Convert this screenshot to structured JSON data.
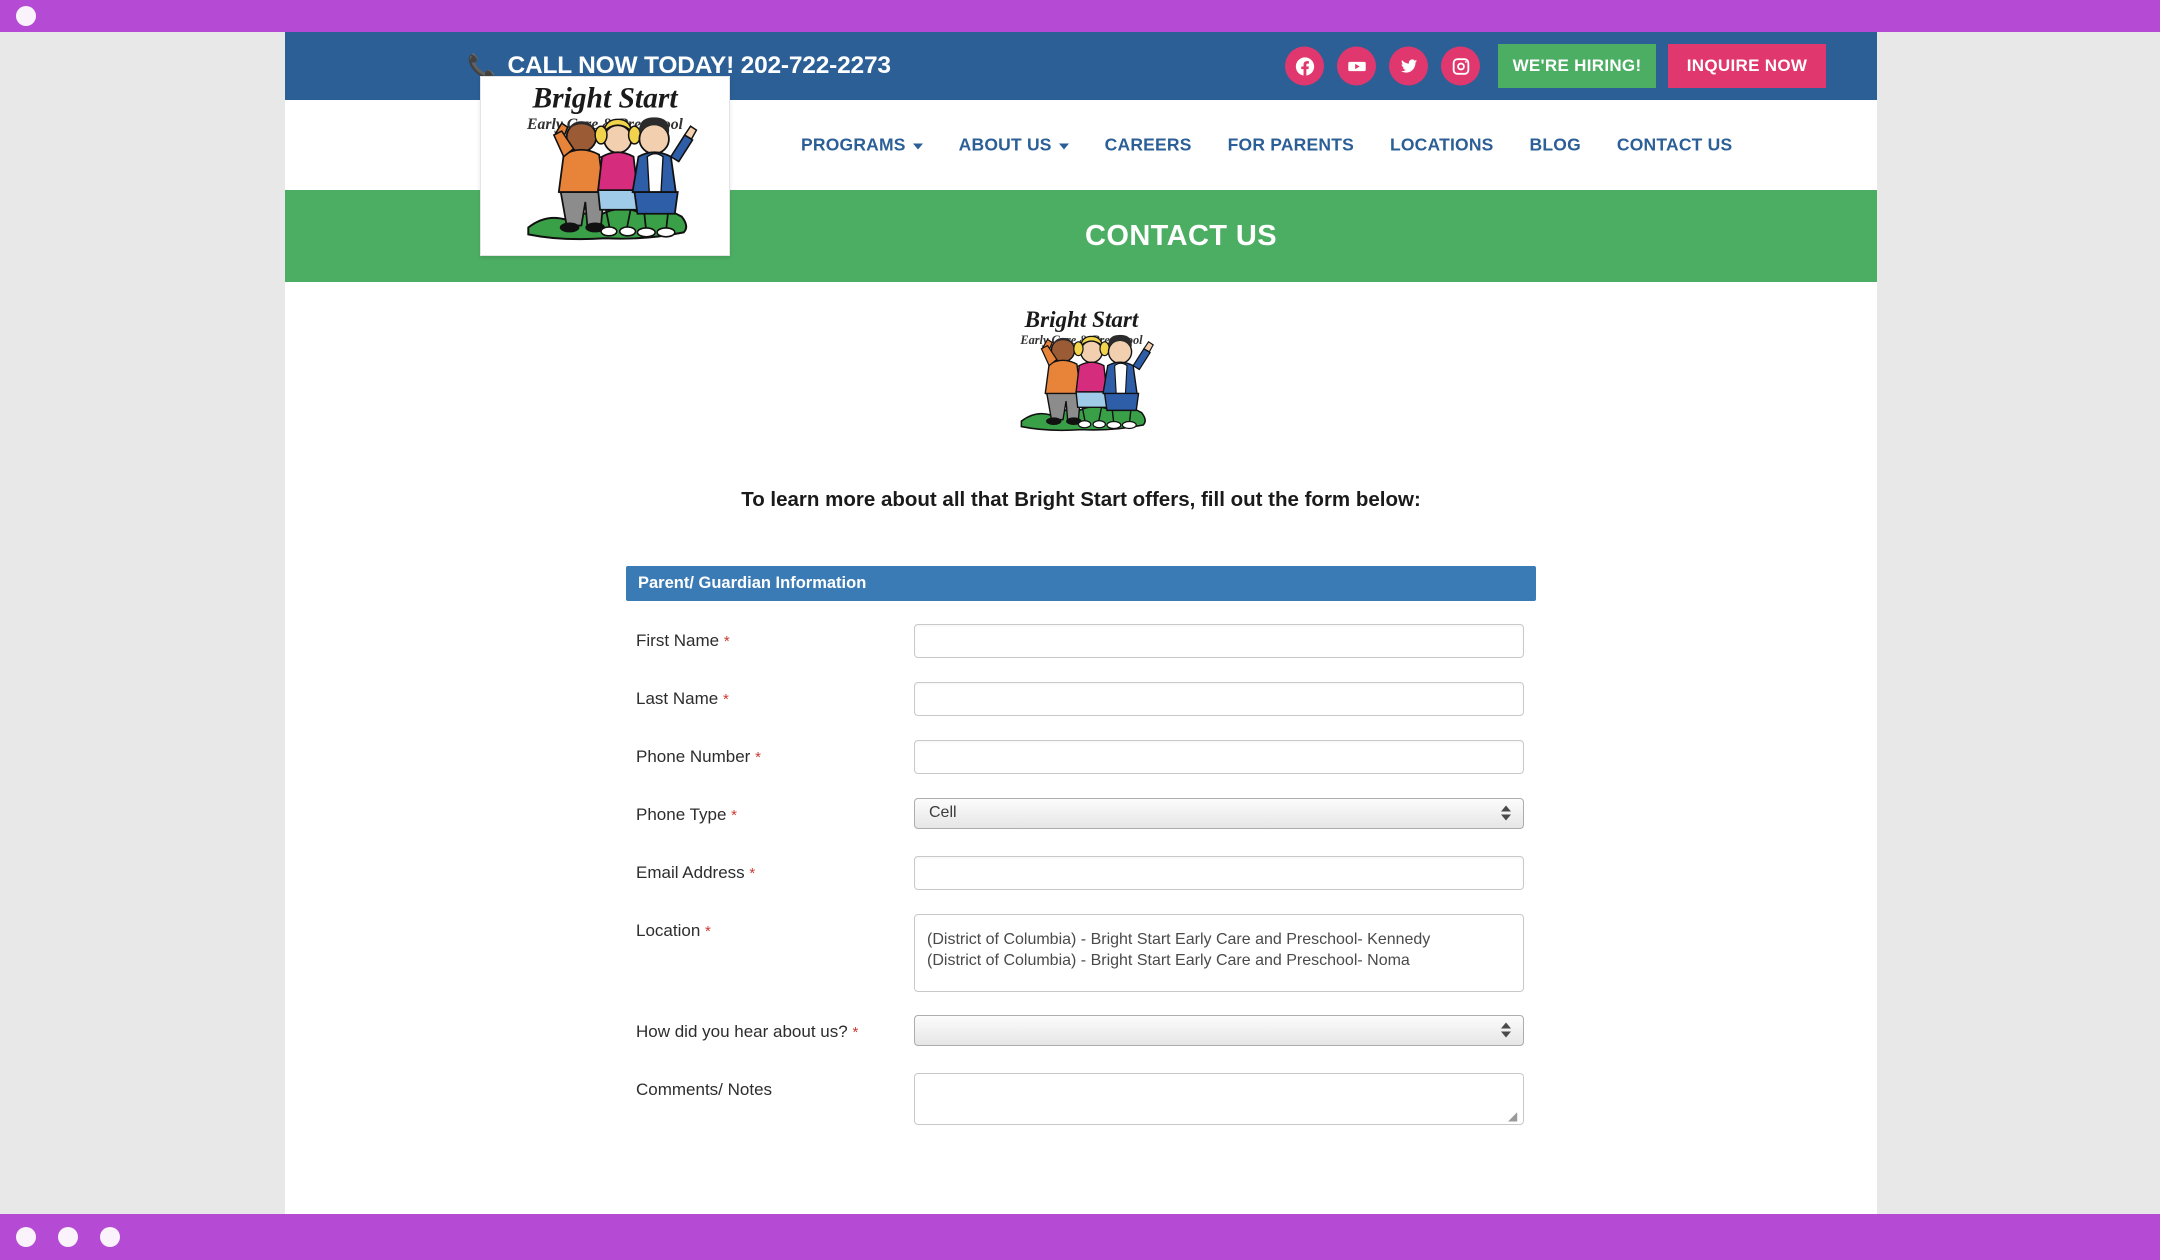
{
  "browser": {
    "top_dots": 1,
    "bottom_dots": 3,
    "chrome_color": "#b54ad4"
  },
  "topbar": {
    "phone_icon": "phone-icon",
    "call_text": "CALL NOW TODAY! 202-722-2273",
    "social": [
      {
        "name": "facebook-icon",
        "label": "Facebook"
      },
      {
        "name": "youtube-icon",
        "label": "YouTube"
      },
      {
        "name": "twitter-icon",
        "label": "Twitter"
      },
      {
        "name": "instagram-icon",
        "label": "Instagram"
      }
    ],
    "hiring_label": "WE'RE HIRING!",
    "inquire_label": "INQUIRE NOW",
    "bg_color": "#2b5f96",
    "hiring_color": "#4cae63",
    "inquire_color": "#e0386e"
  },
  "logo": {
    "title": "Bright Start",
    "subtitle": "Early Care & Preschool"
  },
  "nav": {
    "items": [
      {
        "label": "PROGRAMS",
        "caret": true
      },
      {
        "label": "ABOUT US",
        "caret": true
      },
      {
        "label": "CAREERS",
        "caret": false
      },
      {
        "label": "FOR PARENTS",
        "caret": false
      },
      {
        "label": "LOCATIONS",
        "caret": false
      },
      {
        "label": "BLOG",
        "caret": false
      },
      {
        "label": "CONTACT US",
        "caret": false
      }
    ],
    "color": "#2b5f96"
  },
  "page": {
    "title_band": "CONTACT US",
    "band_color": "#4cae63",
    "lede": "To learn more about all that Bright Start offers, fill out the form below:"
  },
  "form": {
    "section_title": "Parent/ Guardian Information",
    "section_color": "#3b7bb5",
    "required_mark": "*",
    "fields": [
      {
        "label": "First Name",
        "required": true,
        "type": "text",
        "value": ""
      },
      {
        "label": "Last Name",
        "required": true,
        "type": "text",
        "value": ""
      },
      {
        "label": "Phone Number",
        "required": true,
        "type": "text",
        "value": ""
      },
      {
        "label": "Phone Type",
        "required": true,
        "type": "select",
        "value": "Cell"
      },
      {
        "label": "Email Address",
        "required": true,
        "type": "text",
        "value": ""
      },
      {
        "label": "Location",
        "required": true,
        "type": "multiselect",
        "options": [
          "(District of Columbia) - Bright Start Early Care and Preschool- Kennedy",
          "(District of Columbia) - Bright Start Early Care and Preschool- Noma"
        ]
      },
      {
        "label": "How did you hear about us?",
        "required": true,
        "type": "select",
        "value": ""
      },
      {
        "label": "Comments/ Notes",
        "required": false,
        "type": "textarea",
        "value": ""
      }
    ]
  }
}
